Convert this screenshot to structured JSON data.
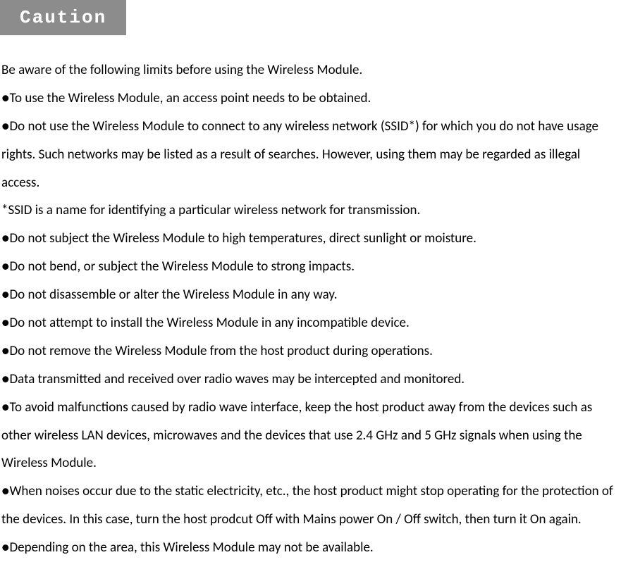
{
  "header": {
    "title": "Caution"
  },
  "intro": "Be aware of the following limits before using the Wireless Module.",
  "items": {
    "b1": "●To use the Wireless Module, an access point needs to be obtained.",
    "b2": "●Do not use the Wireless Module to connect to any wireless network (SSID*) for which you do not have usage rights. Such networks may be listed as a result of searches. However, using them may be regarded as illegal access.",
    "note1": "*SSID is a name for identifying a particular wireless network for transmission.",
    "b3": "●Do not subject the Wireless Module to high temperatures, direct sunlight or moisture.",
    "b4": "●Do not bend, or subject the Wireless Module to strong impacts.",
    "b5": "●Do not disassemble or alter the Wireless Module in any way.",
    "b6": "●Do not attempt to install the Wireless Module in any incompatible device.",
    "b7": "●Do not remove the Wireless Module from the host product during operations.",
    "b8": "●Data transmitted and received over radio waves may be intercepted and monitored.",
    "b9": "●To avoid malfunctions caused by radio wave interface, keep the host product away from the devices such as other wireless LAN devices, microwaves and the devices that use 2.4 GHz and 5 GHz signals when using the Wireless Module.",
    "b10": "●When noises occur due to the static electricity, etc., the host product might stop operating for the protection of the devices. In this case, turn the host prodcut Off with Mains power On / Off switch, then turn it On again.",
    "b11": "●Depending on the area, this Wireless Module may not be available."
  }
}
